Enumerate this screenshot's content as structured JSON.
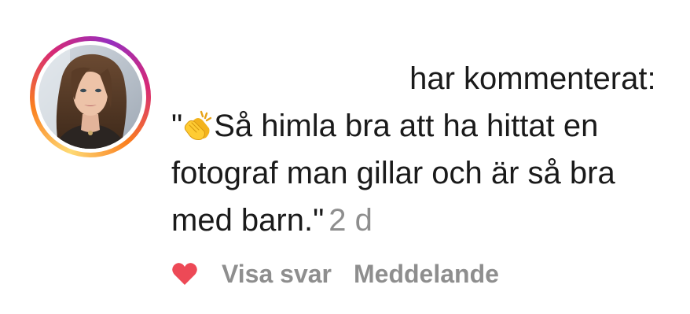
{
  "avatar": {
    "alt": "profile photo",
    "ring_colors": [
      "#feda75",
      "#fa7e1e",
      "#d62976",
      "#962fbf"
    ]
  },
  "comment": {
    "header_suffix": "har kommenterat:",
    "open_quote": "\"",
    "emoji": "clapping-hands-icon",
    "line1": "Så himla bra att ha hittat en",
    "line2": "fotograf man gillar och är så bra",
    "line3": "med barn.\"",
    "timestamp": "2 d"
  },
  "actions": {
    "like_icon": "heart-icon",
    "like_color": "#ed4956",
    "view_replies": "Visa svar",
    "message": "Meddelande"
  }
}
